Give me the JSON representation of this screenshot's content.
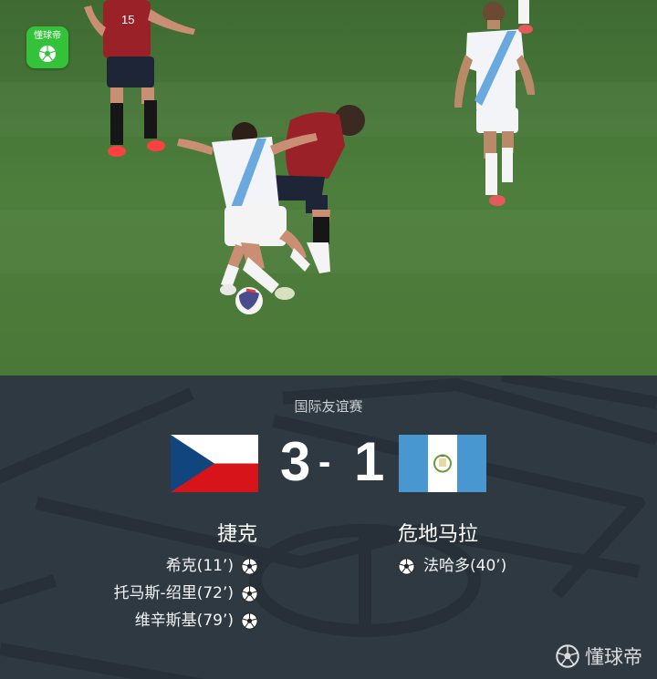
{
  "app_logo": {
    "text": "懂球帝",
    "icon": "soccer-ball-icon",
    "color": "#33c23a"
  },
  "match": {
    "competition": "国际友谊赛",
    "home": {
      "name": "捷克",
      "score": "3",
      "flag": "czech-flag",
      "scorers": [
        "希克(11’)",
        "托马斯-绍里(72’)",
        "维辛斯基(79’)"
      ]
    },
    "away": {
      "name": "危地马拉",
      "score": "1",
      "flag": "guatemala-flag",
      "scorers": [
        "法哈多(40’)"
      ]
    },
    "separator": "-"
  },
  "watermark": {
    "text": "懂球帝",
    "icon": "soccer-ball-icon"
  },
  "colors": {
    "panel_bg": "#2f3942",
    "pitch": "#4a7a38",
    "czech_red": "#d7141a",
    "czech_blue": "#11457e",
    "guatemala_blue": "#4997d0"
  }
}
